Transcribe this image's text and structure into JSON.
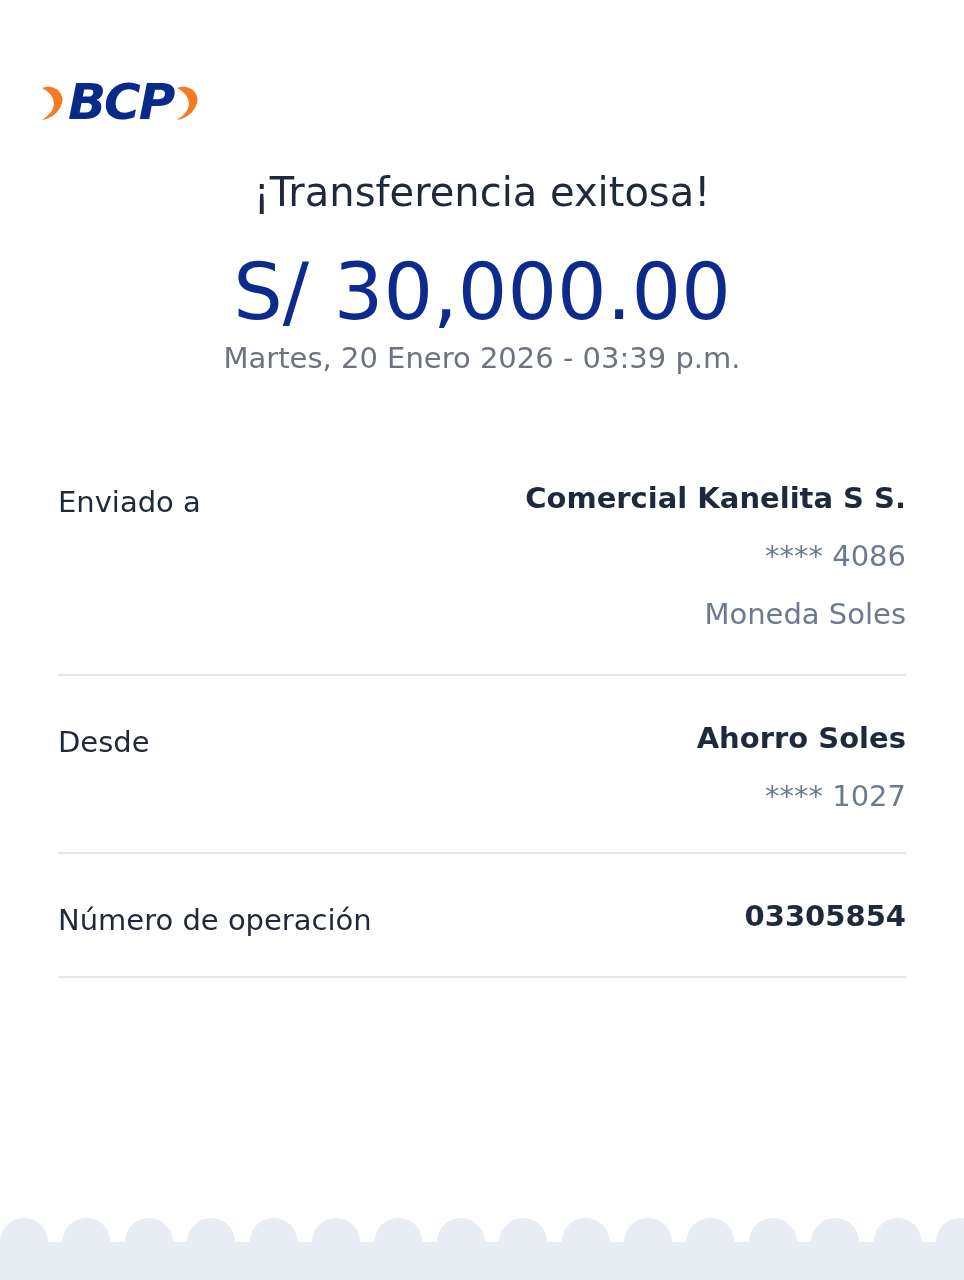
{
  "logo": {
    "text": "BCP"
  },
  "title": "¡Transferencia exitosa!",
  "amount": "S/ 30,000.00",
  "datetime": "Martes, 20 Enero 2026 - 03:39 p.m.",
  "details": [
    {
      "label": "Enviado a",
      "lines": [
        {
          "text": "Comercial Kanelita S S.",
          "kind": "primary"
        },
        {
          "text": "**** 4086",
          "kind": "secondary"
        },
        {
          "text": "Moneda Soles",
          "kind": "secondary"
        }
      ]
    },
    {
      "label": "Desde",
      "lines": [
        {
          "text": "Ahorro Soles",
          "kind": "primary"
        },
        {
          "text": "**** 1027",
          "kind": "secondary"
        }
      ]
    },
    {
      "label": "Número de operación",
      "lines": [
        {
          "text": "03305854",
          "kind": "primary"
        }
      ]
    }
  ]
}
